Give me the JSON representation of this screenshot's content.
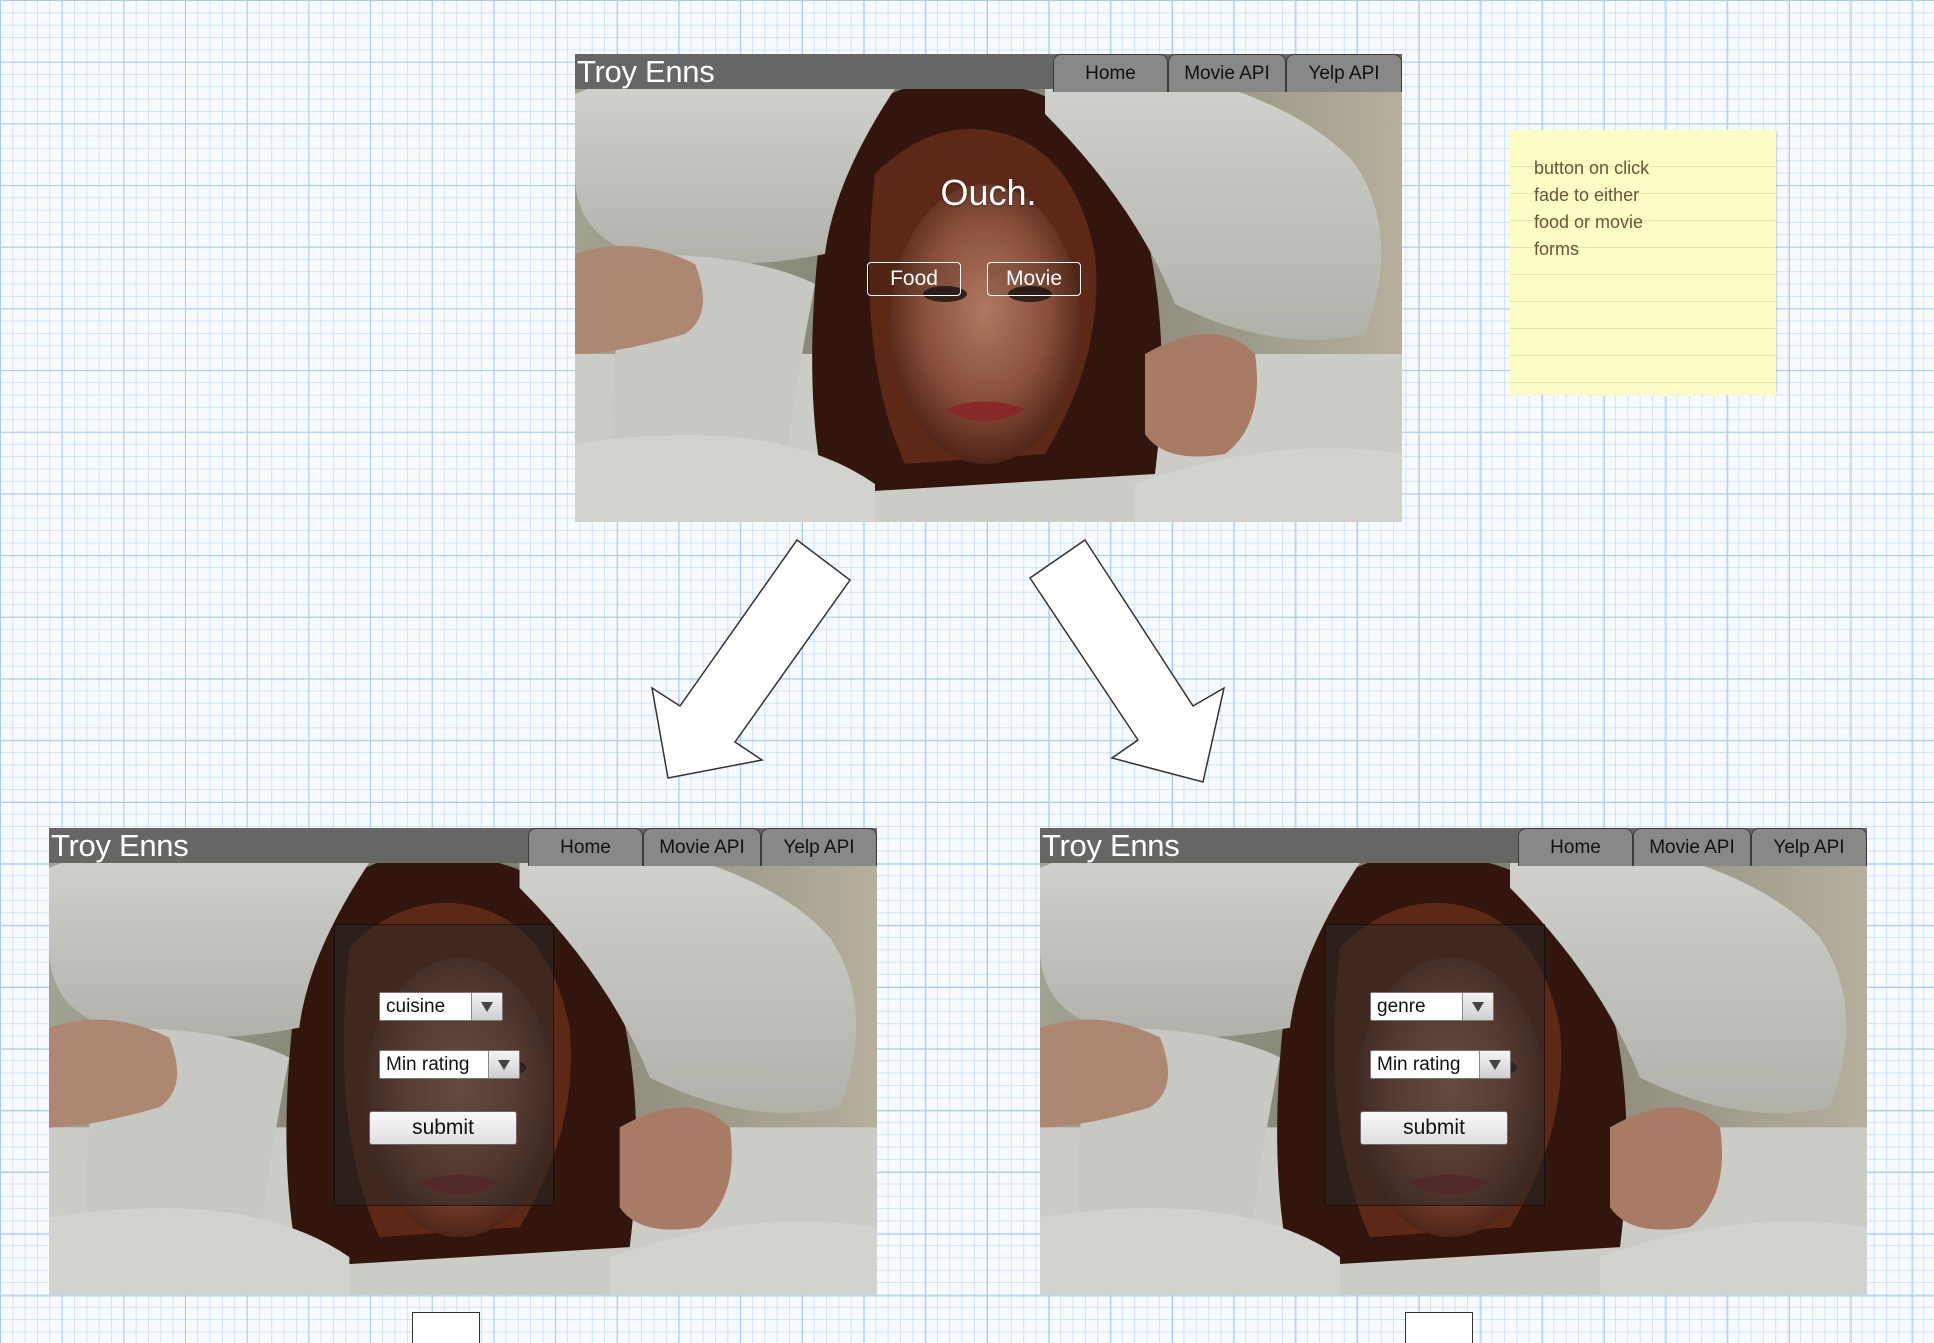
{
  "mockups": {
    "top": {
      "brand": "Troy Enns",
      "nav": [
        "Home",
        "Movie API",
        "Yelp API"
      ],
      "headline": "Ouch.",
      "buttons": [
        "Food",
        "Movie"
      ]
    },
    "food_form": {
      "brand": "Troy Enns",
      "nav": [
        "Home",
        "Movie API",
        "Yelp API"
      ],
      "select_1": "cuisine",
      "select_2": "Min rating",
      "submit": "submit"
    },
    "movie_form": {
      "brand": "Troy Enns",
      "nav": [
        "Home",
        "Movie API",
        "Yelp API"
      ],
      "select_1": "genre",
      "select_2": "Min rating",
      "submit": "submit"
    }
  },
  "sticky_note": {
    "lines": [
      "button on click",
      "fade to either",
      "food or movie",
      "forms"
    ],
    "color": "#fdfcc4"
  },
  "colors": {
    "grid": "#a9cbee",
    "topbar": "#666664",
    "tab": "#888888"
  }
}
